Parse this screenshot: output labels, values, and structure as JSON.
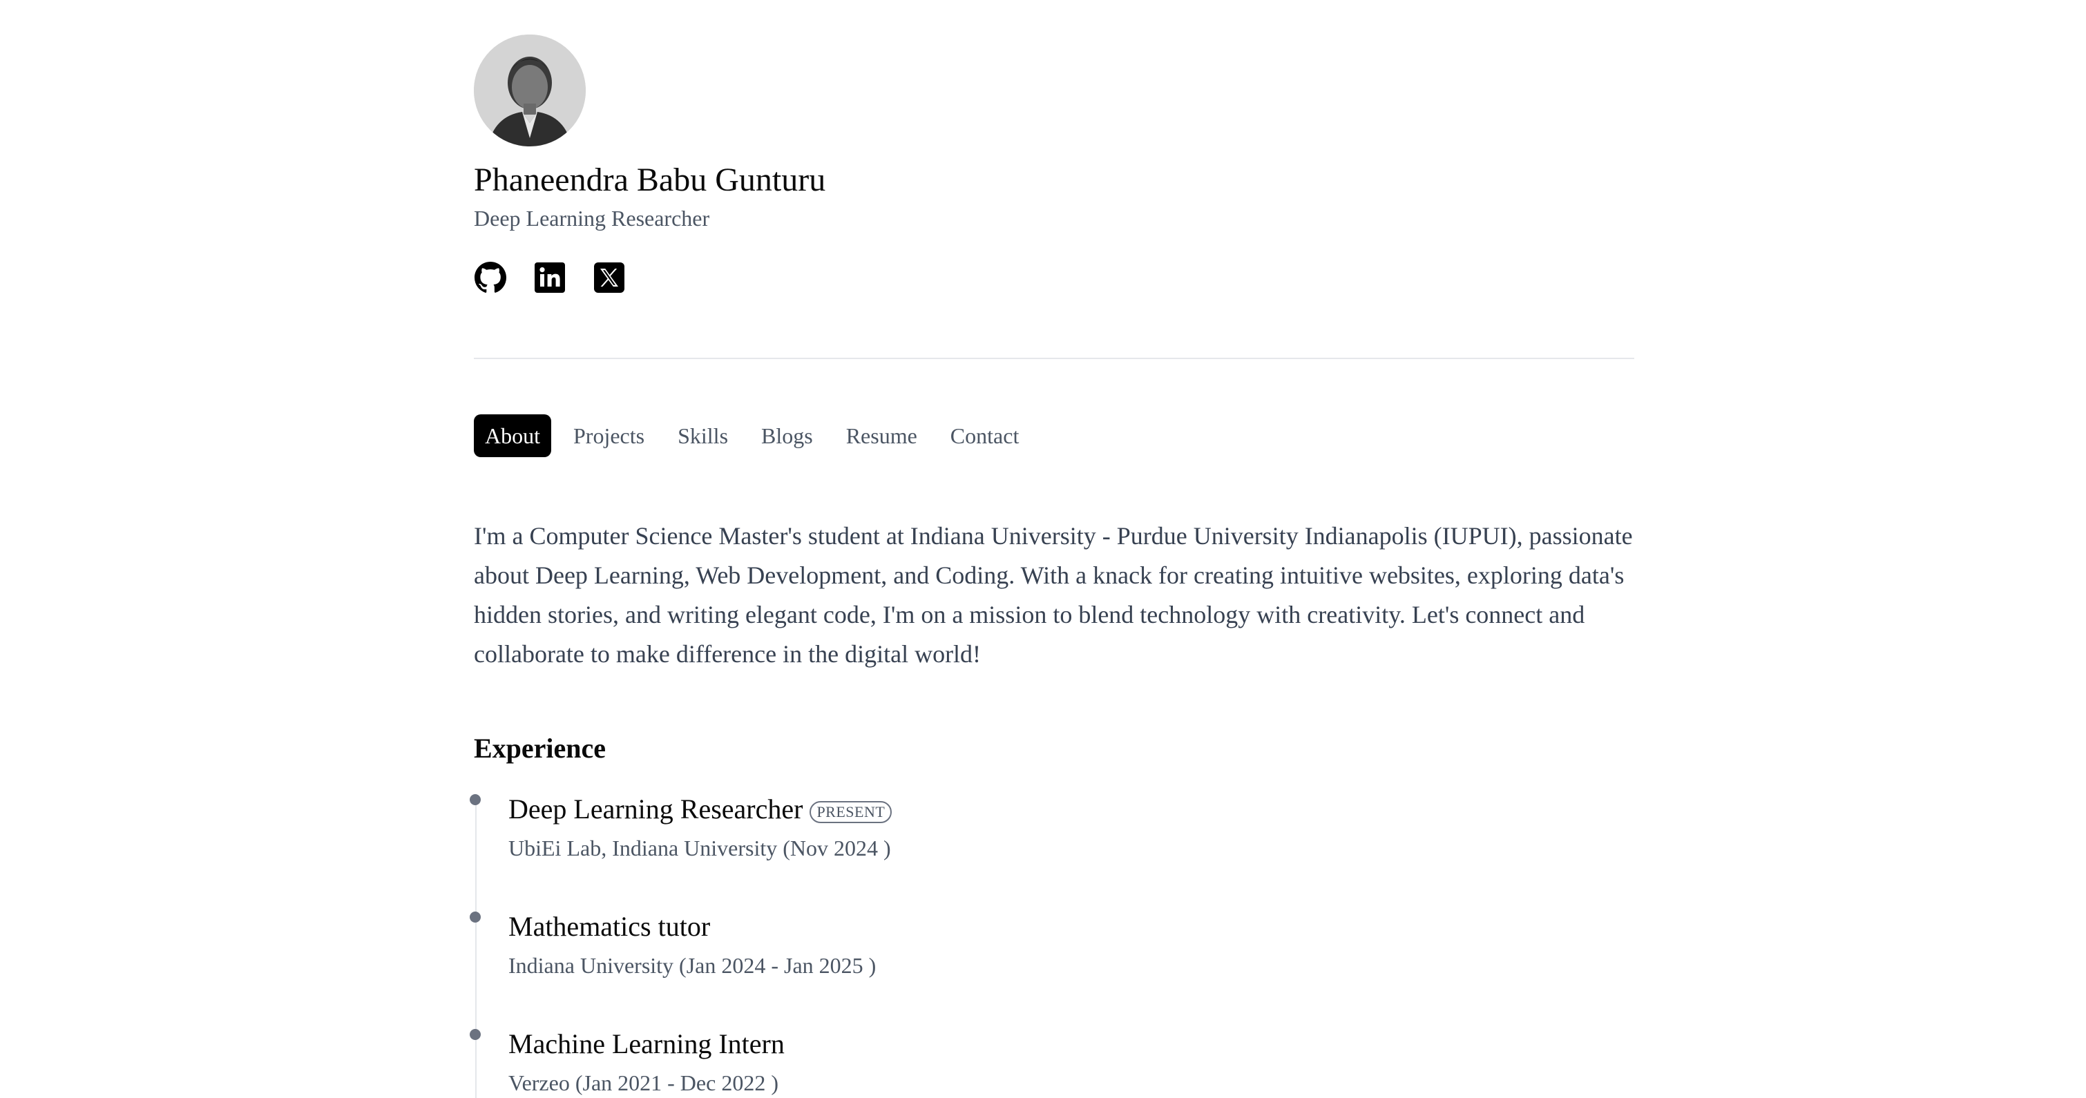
{
  "profile": {
    "name": "Phaneendra Babu Gunturu",
    "title": "Deep Learning Researcher",
    "avatar_alt": "profile-photo"
  },
  "socials": [
    {
      "name": "github-icon"
    },
    {
      "name": "linkedin-icon"
    },
    {
      "name": "x-icon"
    }
  ],
  "tabs": [
    {
      "label": "About",
      "active": true
    },
    {
      "label": "Projects",
      "active": false
    },
    {
      "label": "Skills",
      "active": false
    },
    {
      "label": "Blogs",
      "active": false
    },
    {
      "label": "Resume",
      "active": false
    },
    {
      "label": "Contact",
      "active": false
    }
  ],
  "about": {
    "text": "I'm a Computer Science Master's student at Indiana University - Purdue University Indianapolis (IUPUI), passionate about Deep Learning, Web Development, and Coding. With a knack for creating intuitive websites, exploring data's hidden stories, and writing elegant code, I'm on a mission to blend technology with creativity. Let's connect and collaborate to make difference in the digital world!"
  },
  "experience": {
    "heading": "Experience",
    "items": [
      {
        "role": "Deep Learning Researcher",
        "badge": "PRESENT",
        "org": "UbiEi Lab, Indiana University (Nov 2024 )"
      },
      {
        "role": "Mathematics tutor",
        "badge": "",
        "org": "Indiana University (Jan 2024 - Jan 2025 )"
      },
      {
        "role": "Machine Learning Intern",
        "badge": "",
        "org": "Verzeo (Jan 2021 - Dec 2022 )"
      }
    ]
  },
  "colors": {
    "accent": "#000000",
    "text_muted": "#4b5563",
    "timeline_dot": "#6b7280",
    "divider": "#e5e7eb"
  }
}
